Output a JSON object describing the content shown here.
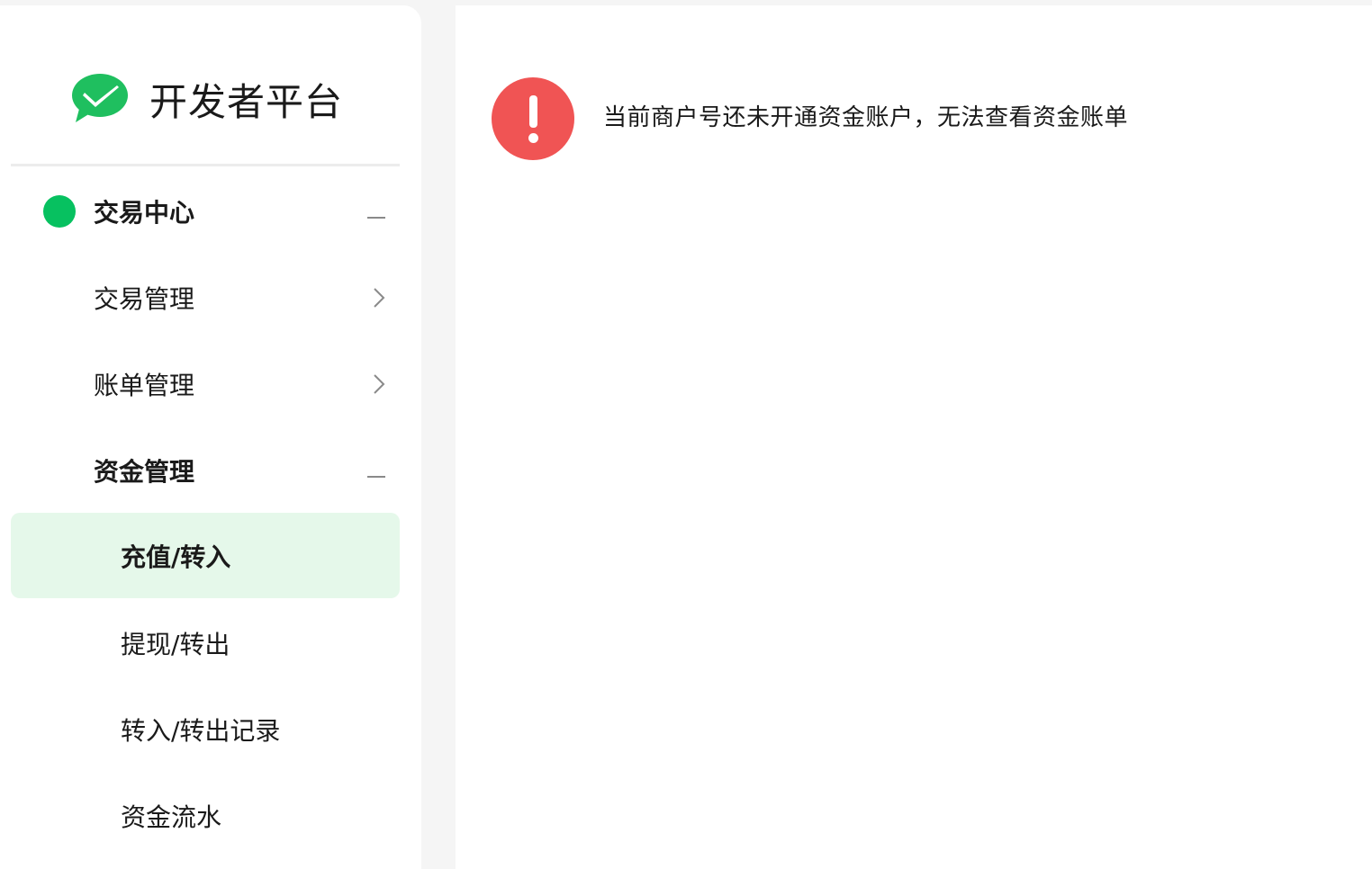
{
  "app": {
    "title": "开发者平台",
    "logo_icon": "wechat-pay-icon",
    "brand_color": "#07c160"
  },
  "sidebar": {
    "section": {
      "label": "交易中心",
      "state_icon": "collapse-minus-icon"
    },
    "items": [
      {
        "label": "交易管理",
        "icon": "chevron-right-icon"
      },
      {
        "label": "账单管理",
        "icon": "chevron-right-icon"
      },
      {
        "label": "资金管理",
        "icon": "collapse-minus-icon",
        "expanded": true
      }
    ],
    "subitems": [
      {
        "label": "充值/转入",
        "active": true
      },
      {
        "label": "提现/转出"
      },
      {
        "label": "转入/转出记录"
      },
      {
        "label": "资金流水"
      }
    ]
  },
  "main": {
    "alert": {
      "icon": "exclamation-icon",
      "color": "#f05454",
      "message": "当前商户号还未开通资金账户，无法查看资金账单"
    }
  }
}
